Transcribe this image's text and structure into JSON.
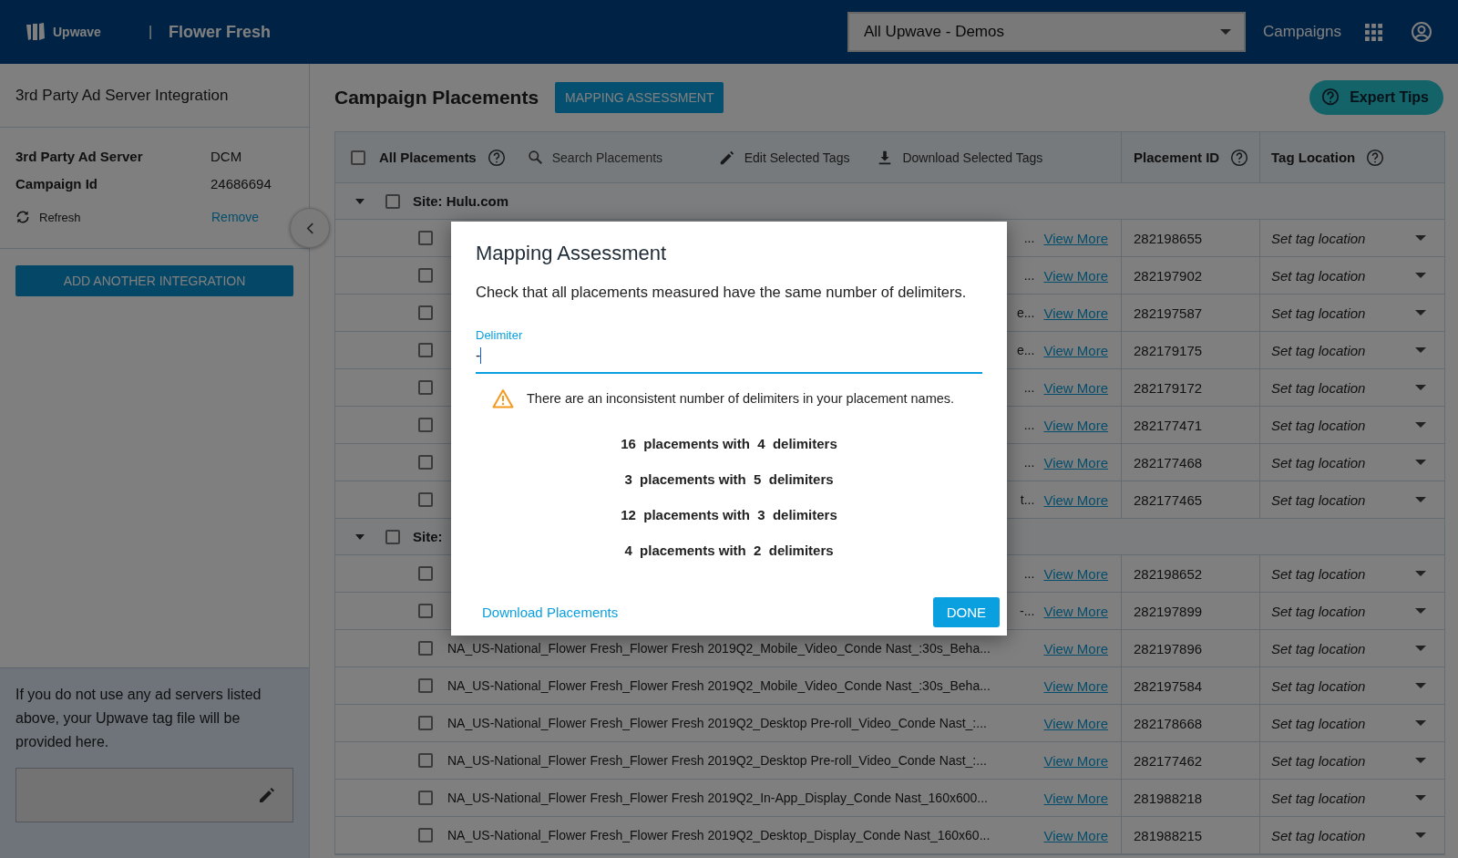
{
  "header": {
    "logo_text": "Upwave",
    "separator": "|",
    "brand": "Flower Fresh",
    "account_select": {
      "value": "All Upwave - Demos"
    },
    "nav_link": "Campaigns"
  },
  "sidebar": {
    "title": "3rd Party Ad Server Integration",
    "fields": [
      {
        "label": "3rd Party Ad Server",
        "value": "DCM"
      },
      {
        "label": "Campaign Id",
        "value": "24686694"
      }
    ],
    "refresh": "Refresh",
    "remove": "Remove",
    "add_button": "ADD ANOTHER INTEGRATION",
    "note": "If you do not use any ad servers listed above, your Upwave tag file will be provided here."
  },
  "main": {
    "title": "Campaign Placements",
    "mapping_button": "MAPPING ASSESSMENT",
    "expert_tips": "Expert Tips"
  },
  "table": {
    "toolbar": {
      "all_label": "All Placements",
      "all_checked": false,
      "search_placeholder": "Search Placements",
      "edit": "Edit Selected Tags",
      "download": "Download Selected Tags"
    },
    "columns": [
      "Placement ID",
      "Tag Location"
    ],
    "groups": [
      {
        "site": "Site: Hulu.com",
        "expanded": true,
        "checked": false,
        "rows": [
          {
            "name_tail": "...",
            "link": "View More",
            "placement_id": "282198655",
            "tag_location": "Set tag location",
            "checked": false
          },
          {
            "name_tail": "...",
            "link": "View More",
            "placement_id": "282197902",
            "tag_location": "Set tag location",
            "checked": false
          },
          {
            "name_tail": "e...",
            "link": "View More",
            "placement_id": "282197587",
            "tag_location": "Set tag location",
            "checked": false
          },
          {
            "name_tail": "e...",
            "link": "View More",
            "placement_id": "282179175",
            "tag_location": "Set tag location",
            "checked": false
          },
          {
            "name_tail": "...",
            "link": "View More",
            "placement_id": "282179172",
            "tag_location": "Set tag location",
            "checked": false
          },
          {
            "name_tail": "...",
            "link": "View More",
            "placement_id": "282177471",
            "tag_location": "Set tag location",
            "checked": false
          },
          {
            "name_tail": "...",
            "link": "View More",
            "placement_id": "282177468",
            "tag_location": "Set tag location",
            "checked": false
          },
          {
            "name_tail": "t...",
            "link": "View More",
            "placement_id": "282177465",
            "tag_location": "Set tag location",
            "checked": false
          }
        ]
      },
      {
        "site": "Site:",
        "expanded": true,
        "checked": false,
        "rows": [
          {
            "name_tail": "...",
            "link": "View More",
            "placement_id": "282198652",
            "tag_location": "Set tag location",
            "checked": false
          },
          {
            "name_tail": "-...",
            "link": "View More",
            "placement_id": "282197899",
            "tag_location": "Set tag location",
            "checked": false
          },
          {
            "name": "NA_US-National_Flower Fresh_Flower Fresh 2019Q2_Mobile_Video_Conde Nast_:30s_Beha...",
            "link": "View More",
            "placement_id": "282197896",
            "tag_location": "Set tag location",
            "checked": false
          },
          {
            "name": "NA_US-National_Flower Fresh_Flower Fresh 2019Q2_Mobile_Video_Conde Nast_:30s_Beha...",
            "link": "View More",
            "placement_id": "282197584",
            "tag_location": "Set tag location",
            "checked": false
          },
          {
            "name": "NA_US-National_Flower Fresh_Flower Fresh 2019Q2_Desktop Pre-roll_Video_Conde Nast_:...",
            "link": "View More",
            "placement_id": "282178668",
            "tag_location": "Set tag location",
            "checked": false
          },
          {
            "name": "NA_US-National_Flower Fresh_Flower Fresh 2019Q2_Desktop Pre-roll_Video_Conde Nast_:...",
            "link": "View More",
            "placement_id": "282177462",
            "tag_location": "Set tag location",
            "checked": false
          },
          {
            "name": "NA_US-National_Flower Fresh_Flower Fresh 2019Q2_In-App_Display_Conde Nast_160x600...",
            "link": "View More",
            "placement_id": "281988218",
            "tag_location": "Set tag location",
            "checked": false
          },
          {
            "name": "NA_US-National_Flower Fresh_Flower Fresh 2019Q2_Desktop_Display_Conde Nast_160x60...",
            "link": "View More",
            "placement_id": "281988215",
            "tag_location": "Set tag location",
            "checked": false
          }
        ]
      }
    ]
  },
  "modal": {
    "title": "Mapping Assessment",
    "description": "Check that all placements measured have the same number of delimiters.",
    "field": {
      "label": "Delimiter",
      "value": "-"
    },
    "warning": "There are an inconsistent number of delimiters in your placement names.",
    "counts": [
      "16  placements with  4  delimiters",
      "3  placements with  5  delimiters",
      "12  placements with  3  delimiters",
      "4  placements with  2  delimiters"
    ],
    "download_link": "Download Placements",
    "done_button": "DONE"
  }
}
